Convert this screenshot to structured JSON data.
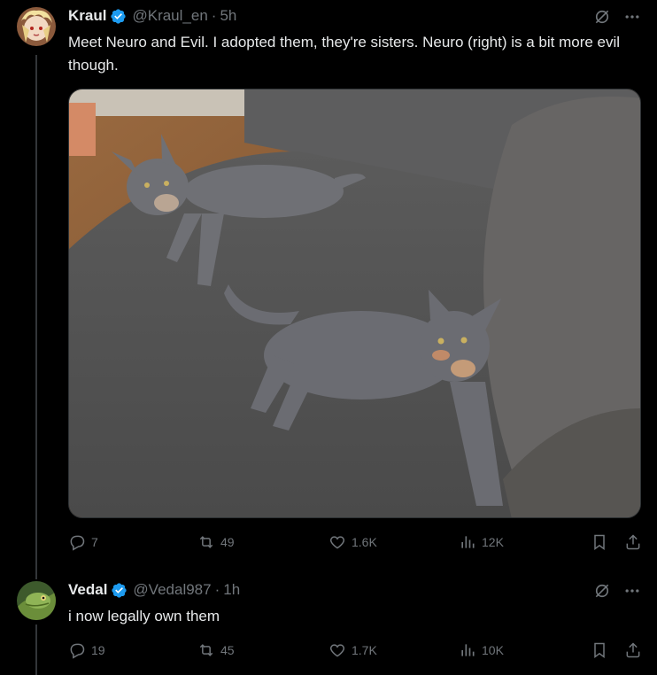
{
  "posts": [
    {
      "author": {
        "name": "Kraul",
        "handle": "@Kraul_en",
        "time": "5h",
        "verified": true
      },
      "text": "Meet Neuro and Evil. I adopted them, they're sisters. Neuro (right) is a bit more evil though.",
      "media": {
        "type": "photo",
        "icon": "cats-photo"
      },
      "stats": {
        "replies": "7",
        "reposts": "49",
        "likes": "1.6K",
        "views": "12K"
      }
    },
    {
      "author": {
        "name": "Vedal",
        "handle": "@Vedal987",
        "time": "1h",
        "verified": true
      },
      "text": "i now legally own them",
      "stats": {
        "replies": "19",
        "reposts": "45",
        "likes": "1.7K",
        "views": "10K"
      }
    }
  ],
  "separator": "·",
  "colors": {
    "background": "#000000",
    "text": "#e7e9ea",
    "muted": "#71767b",
    "verified": "#1d9bf0",
    "line": "#333639"
  }
}
